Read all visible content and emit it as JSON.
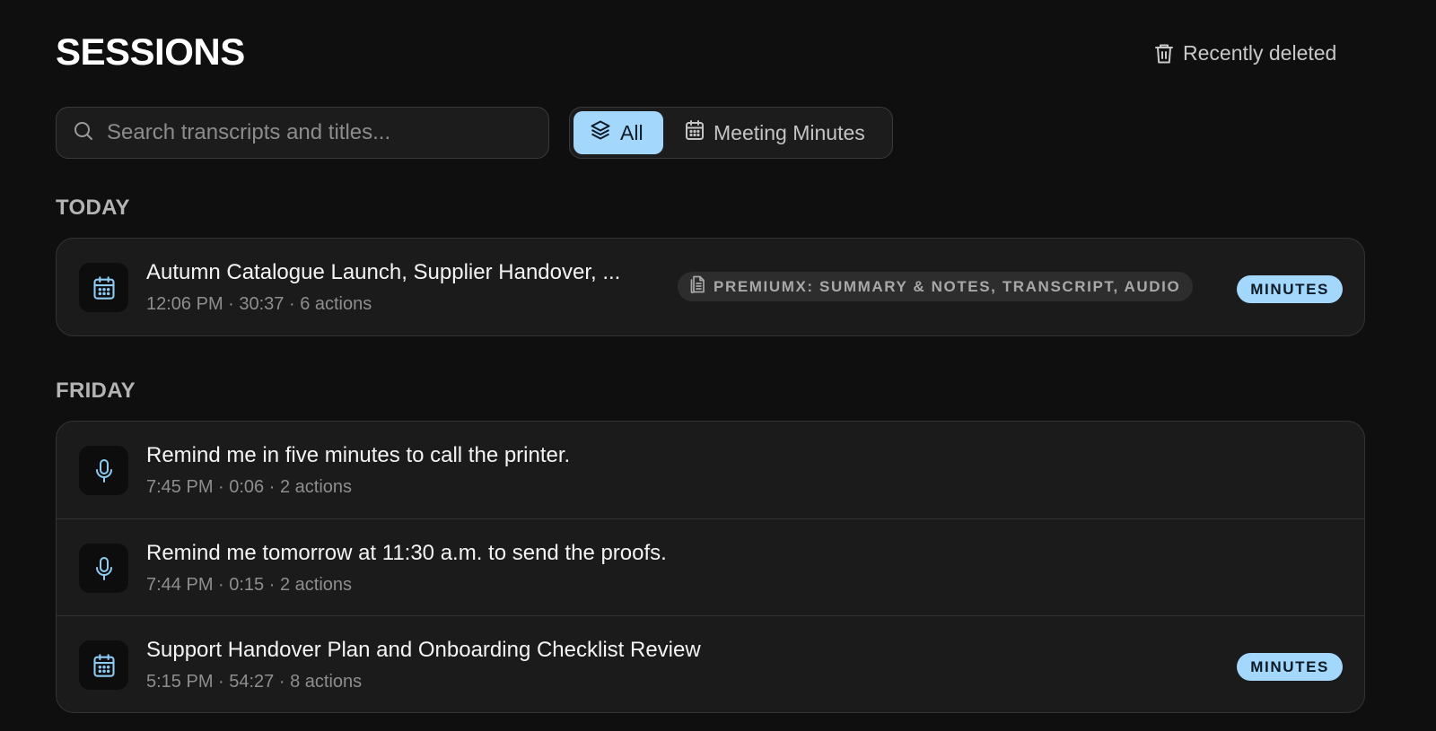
{
  "header": {
    "title": "SESSIONS",
    "recently_deleted_label": "Recently deleted"
  },
  "search": {
    "placeholder": "Search transcripts and titles...",
    "value": ""
  },
  "filters": [
    {
      "label": "All",
      "icon": "layers-icon",
      "active": true
    },
    {
      "label": "Meeting Minutes",
      "icon": "calendar-icon",
      "active": false
    }
  ],
  "sections": [
    {
      "label": "TODAY",
      "items": [
        {
          "icon": "calendar-icon",
          "title": "Autumn Catalogue Launch, Supplier Handover, ...",
          "meta": "12:06 PM · 30:37 · 6 actions",
          "chip": "PREMIUMX: SUMMARY & NOTES, TRANSCRIPT, AUDIO",
          "badge": "MINUTES"
        }
      ]
    },
    {
      "label": "FRIDAY",
      "items": [
        {
          "icon": "microphone-icon",
          "title": "Remind me in five minutes to call the printer.",
          "meta": "7:45 PM · 0:06 · 2 actions"
        },
        {
          "icon": "microphone-icon",
          "title": "Remind me tomorrow at 11:30 a.m. to send the proofs.",
          "meta": "7:44 PM · 0:15 · 2 actions"
        },
        {
          "icon": "calendar-icon",
          "title": "Support Handover Plan and Onboarding Checklist Review",
          "meta": "5:15 PM · 54:27 · 8 actions",
          "badge": "MINUTES"
        }
      ]
    }
  ],
  "colors": {
    "background": "#0f0f0f",
    "card": "#1b1b1b",
    "accent": "#a3d7fb",
    "icon_accent": "#8ccbf2"
  }
}
